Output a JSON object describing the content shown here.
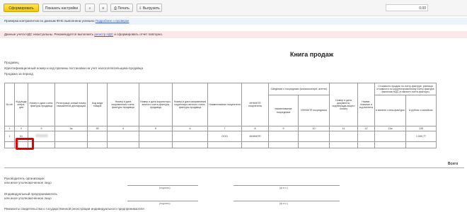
{
  "toolbar": {
    "generate_label": "Сформировать",
    "settings_label": "Показать настройки",
    "search_icon": "⌕",
    "print_label": "Печать",
    "export_label": "Выгрузить",
    "more_icon": "≡",
    "amount_value": "0.00",
    "print_icon": "⎙",
    "export_icon": "⇩"
  },
  "notices": {
    "info_text": "Проверка контрагентов по данным ФНС выполнена успешно",
    "info_link": "Подробнее о проверке",
    "warning_text": "Данные учета НДС неактуальны. Рекомендуется выполнить",
    "warning_link": "регистр НДС",
    "warning_tail": "и сформировать отчет повторно."
  },
  "report": {
    "title": "Книга продаж",
    "seller": "Продавец",
    "inn_line": "Идентификационный номер и код причины постановки на учет налогоплательщика-продавца",
    "period": "Продажа за период"
  },
  "table": {
    "headers": [
      "№ п/п",
      "Код вида опера-ции",
      "Номер и дата счета-фактуры продавца",
      "Регистраци-онный номер таможенной декларации",
      "Код вида товара",
      "Номер и дата исправления счета-фактуры продавца",
      "Номер и дата корректиро-вочного счета-фактуры продавца",
      "Номер и дата исправления корректиро-вочного счета-фактуры продавца",
      "Наименование покупателя",
      "ИНН/КПП покупателя",
      "Сведения о посреднике (комиссионере, агенте)",
      "Номер и дата документа, подтвержда-ющего оплату",
      "Наиме-нование и код валюты",
      "Стоимость продаж по счету-фактуре, разница стоимости по корректировочному счету-фактуре (включая НДС) в валюте счета-фактуры"
    ],
    "sub_headers": {
      "intermediary_name": "наименование посредника",
      "intermediary_inn": "ИНН/КПП посредника",
      "invoice_currency": "в валюте счета-фактуры",
      "rub": "в рублях и копейках"
    },
    "numbers": [
      "1",
      "2",
      "3",
      "3а",
      "3б",
      "4",
      "5",
      "6",
      "7",
      "8",
      "9",
      "10",
      "11",
      "12",
      "13а",
      "13б"
    ],
    "row": {
      "num": "1",
      "code": "01",
      "buyer": "ООО",
      "inn": "ИНН/КПП",
      "amount": "1 000,77"
    },
    "total_label": "Всего"
  },
  "signatures": {
    "head": "Руководитель организации",
    "head_sub": "или иное уполномоченное лицо",
    "entrepreneur": "Индивидуальный предприниматель",
    "entrepreneur_sub": "или иное уполномоченное лицо",
    "sign_caption": "(подпись)",
    "name_caption": "(ф.и.о.)",
    "certificate": "Реквизиты свидетельства о государственной регистрации индивидуального предпринимателя"
  }
}
